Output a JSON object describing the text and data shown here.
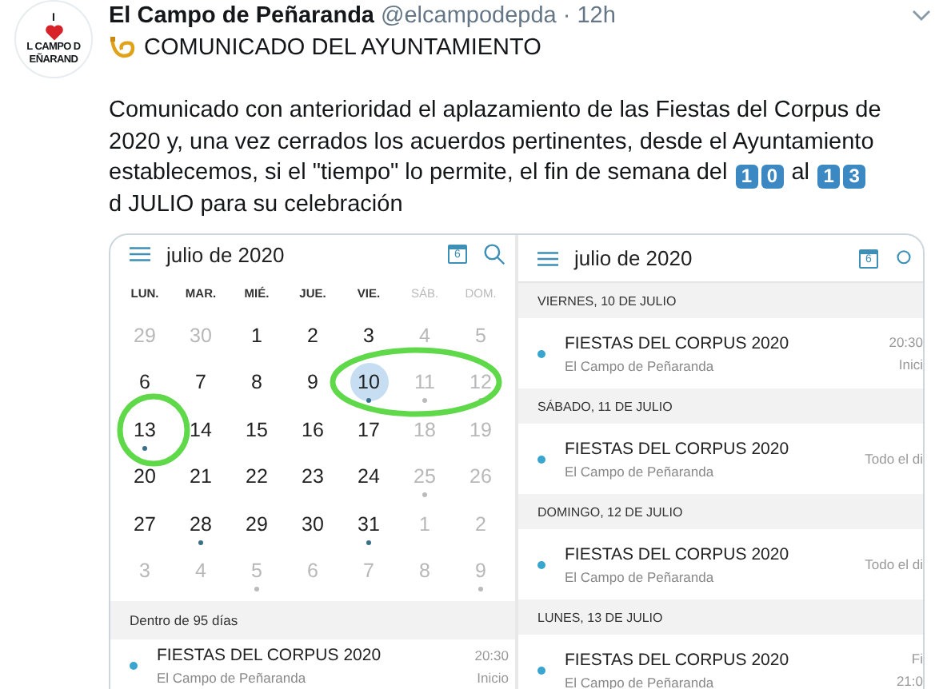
{
  "tweet": {
    "avatar": {
      "lines": [
        "I",
        "L CAMPO D",
        "EÑARAND"
      ]
    },
    "author": "El Campo de Peñaranda",
    "handle": "@elcampodepda",
    "separator": "·",
    "time": "12h",
    "headline": "COMUNICADO DEL AYUNTAMIENTO",
    "body": [
      {
        "kind": "text",
        "text": "Comunicado con anterioridad el aplazamiento de las Fiestas del Corpus de 2020 y, una vez cerrados los acuerdos pertinentes, desde el Ayuntamiento establecemos, si el \"tiempo\" lo permite, el fin de semana del "
      },
      {
        "kind": "keycap",
        "text": "1"
      },
      {
        "kind": "keycap",
        "text": "0"
      },
      {
        "kind": "text",
        "text": " al "
      },
      {
        "kind": "keycap",
        "text": "1"
      },
      {
        "kind": "keycap",
        "text": "3"
      },
      {
        "kind": "text",
        "text": "\n d JULIO para su celebración"
      }
    ]
  },
  "calendar_month": {
    "title": "julio de 2020",
    "today_badge": "6",
    "weekdays": [
      {
        "label": "LUN.",
        "muted": false
      },
      {
        "label": "MAR.",
        "muted": false
      },
      {
        "label": "MIÉ.",
        "muted": false
      },
      {
        "label": "JUE.",
        "muted": false
      },
      {
        "label": "VIE.",
        "muted": false
      },
      {
        "label": "SÁB.",
        "muted": true
      },
      {
        "label": "DOM.",
        "muted": true
      }
    ],
    "weeks": [
      [
        {
          "day": "29",
          "muted": true,
          "dot": false,
          "selected": false
        },
        {
          "day": "30",
          "muted": true,
          "dot": false,
          "selected": false
        },
        {
          "day": "1",
          "muted": false,
          "dot": false,
          "selected": false
        },
        {
          "day": "2",
          "muted": false,
          "dot": false,
          "selected": false
        },
        {
          "day": "3",
          "muted": false,
          "dot": false,
          "selected": false
        },
        {
          "day": "4",
          "muted": true,
          "dot": false,
          "selected": false
        },
        {
          "day": "5",
          "muted": true,
          "dot": false,
          "selected": false
        }
      ],
      [
        {
          "day": "6",
          "muted": false,
          "dot": false,
          "selected": false
        },
        {
          "day": "7",
          "muted": false,
          "dot": false,
          "selected": false
        },
        {
          "day": "8",
          "muted": false,
          "dot": false,
          "selected": false
        },
        {
          "day": "9",
          "muted": false,
          "dot": false,
          "selected": false
        },
        {
          "day": "10",
          "muted": false,
          "dot": true,
          "selected": true
        },
        {
          "day": "11",
          "muted": true,
          "dot": true,
          "selected": false
        },
        {
          "day": "12",
          "muted": true,
          "dot": true,
          "selected": false
        }
      ],
      [
        {
          "day": "13",
          "muted": false,
          "dot": true,
          "selected": false
        },
        {
          "day": "14",
          "muted": false,
          "dot": false,
          "selected": false
        },
        {
          "day": "15",
          "muted": false,
          "dot": false,
          "selected": false
        },
        {
          "day": "16",
          "muted": false,
          "dot": false,
          "selected": false
        },
        {
          "day": "17",
          "muted": false,
          "dot": false,
          "selected": false
        },
        {
          "day": "18",
          "muted": true,
          "dot": false,
          "selected": false
        },
        {
          "day": "19",
          "muted": true,
          "dot": false,
          "selected": false
        }
      ],
      [
        {
          "day": "20",
          "muted": false,
          "dot": false,
          "selected": false
        },
        {
          "day": "21",
          "muted": false,
          "dot": false,
          "selected": false
        },
        {
          "day": "22",
          "muted": false,
          "dot": false,
          "selected": false
        },
        {
          "day": "23",
          "muted": false,
          "dot": false,
          "selected": false
        },
        {
          "day": "24",
          "muted": false,
          "dot": false,
          "selected": false
        },
        {
          "day": "25",
          "muted": true,
          "dot": true,
          "selected": false
        },
        {
          "day": "26",
          "muted": true,
          "dot": false,
          "selected": false
        }
      ],
      [
        {
          "day": "27",
          "muted": false,
          "dot": false,
          "selected": false
        },
        {
          "day": "28",
          "muted": false,
          "dot": true,
          "selected": false
        },
        {
          "day": "29",
          "muted": false,
          "dot": false,
          "selected": false
        },
        {
          "day": "30",
          "muted": false,
          "dot": false,
          "selected": false
        },
        {
          "day": "31",
          "muted": false,
          "dot": true,
          "selected": false
        },
        {
          "day": "1",
          "muted": true,
          "dot": false,
          "selected": false
        },
        {
          "day": "2",
          "muted": true,
          "dot": false,
          "selected": false
        }
      ],
      [
        {
          "day": "3",
          "muted": true,
          "dot": false,
          "selected": false
        },
        {
          "day": "4",
          "muted": true,
          "dot": false,
          "selected": false
        },
        {
          "day": "5",
          "muted": true,
          "dot": true,
          "selected": false
        },
        {
          "day": "6",
          "muted": true,
          "dot": false,
          "selected": false
        },
        {
          "day": "7",
          "muted": true,
          "dot": false,
          "selected": false
        },
        {
          "day": "8",
          "muted": true,
          "dot": false,
          "selected": false
        },
        {
          "day": "9",
          "muted": true,
          "dot": true,
          "selected": false
        }
      ]
    ],
    "upcoming": {
      "header": "Dentro de 95 días",
      "event": {
        "title": "FIESTAS DEL CORPUS 2020",
        "organizer": "El Campo de Peñaranda",
        "side": [
          "20:30",
          "Inicio"
        ]
      }
    }
  },
  "agenda": {
    "title": "julio de 2020",
    "today_badge": "6",
    "days": [
      {
        "header": "VIERNES, 10 DE JULIO",
        "events": [
          {
            "title": "FIESTAS DEL CORPUS 2020",
            "organizer": "El Campo de Peñaranda",
            "side": [
              "20:30",
              "Inici"
            ]
          }
        ]
      },
      {
        "header": "SÁBADO, 11 DE JULIO",
        "events": [
          {
            "title": "FIESTAS DEL CORPUS 2020",
            "organizer": "El Campo de Peñaranda",
            "side": [
              "Todo el di"
            ]
          }
        ]
      },
      {
        "header": "DOMINGO, 12 DE JULIO",
        "events": [
          {
            "title": "FIESTAS DEL CORPUS 2020",
            "organizer": "El Campo de Peñaranda",
            "side": [
              "Todo el di"
            ]
          }
        ]
      },
      {
        "header": "LUNES, 13 DE JULIO",
        "events": [
          {
            "title": "FIESTAS DEL CORPUS 2020",
            "organizer": "El Campo de Peñaranda",
            "side": [
              "Fi",
              "21:0"
            ]
          }
        ]
      }
    ]
  }
}
